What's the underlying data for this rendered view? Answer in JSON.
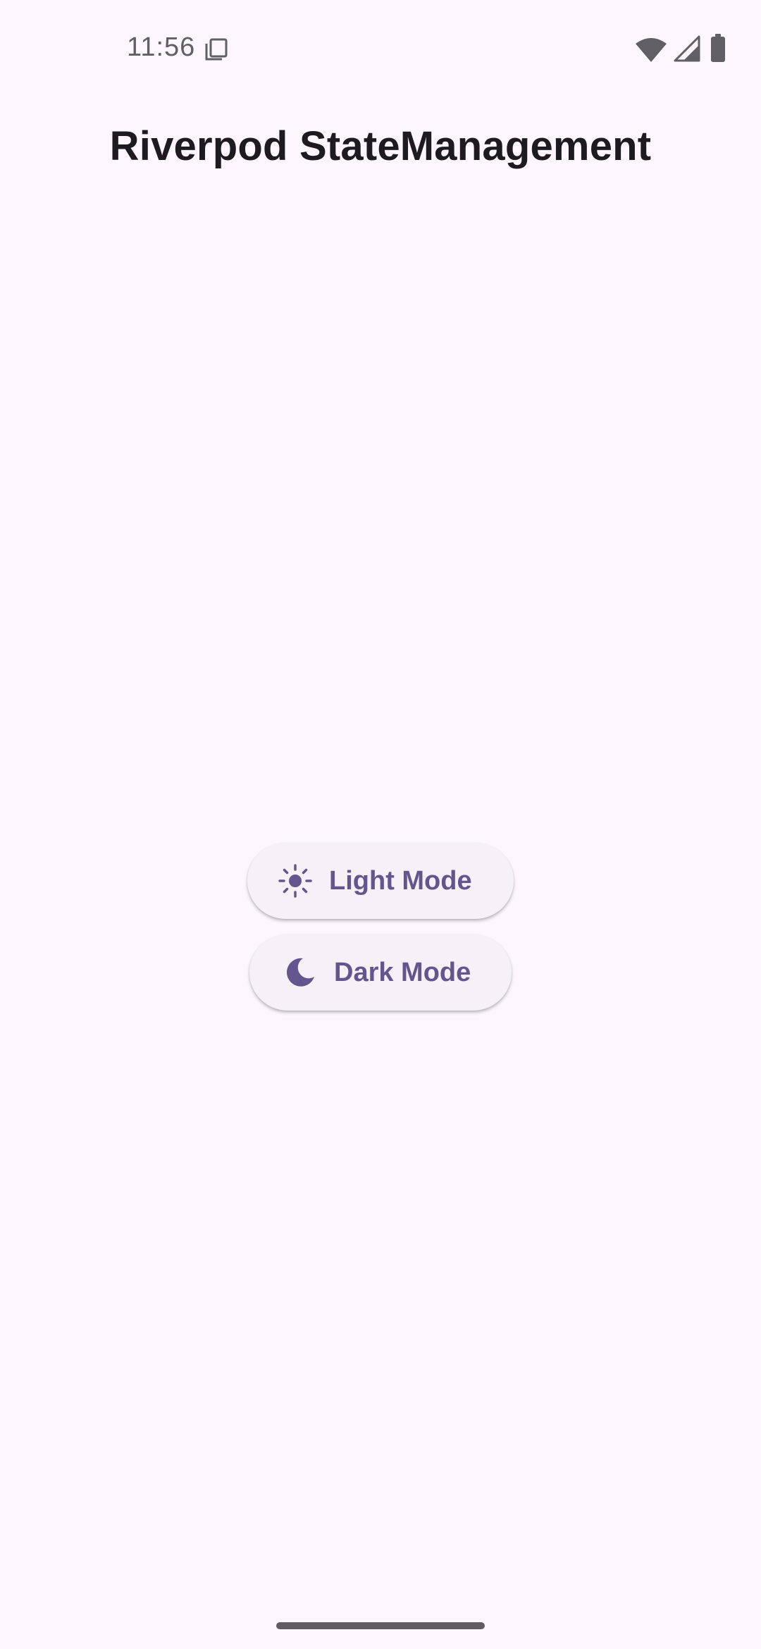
{
  "status_bar": {
    "time": "11:56",
    "left_icon": "screenshot-notification-icon",
    "right_icons": [
      "wifi-icon",
      "signal-icon",
      "battery-icon"
    ]
  },
  "app_bar": {
    "title": "Riverpod StateManagement"
  },
  "buttons": {
    "light": {
      "label": "Light Mode",
      "icon": "sun-icon"
    },
    "dark": {
      "label": "Dark Mode",
      "icon": "moon-icon"
    }
  },
  "colors": {
    "background": "#fdf7fd",
    "button_surface": "#f6f1f7",
    "accent": "#65558f",
    "title_text": "#1d1b20",
    "status_icons": "#5f5f65"
  }
}
